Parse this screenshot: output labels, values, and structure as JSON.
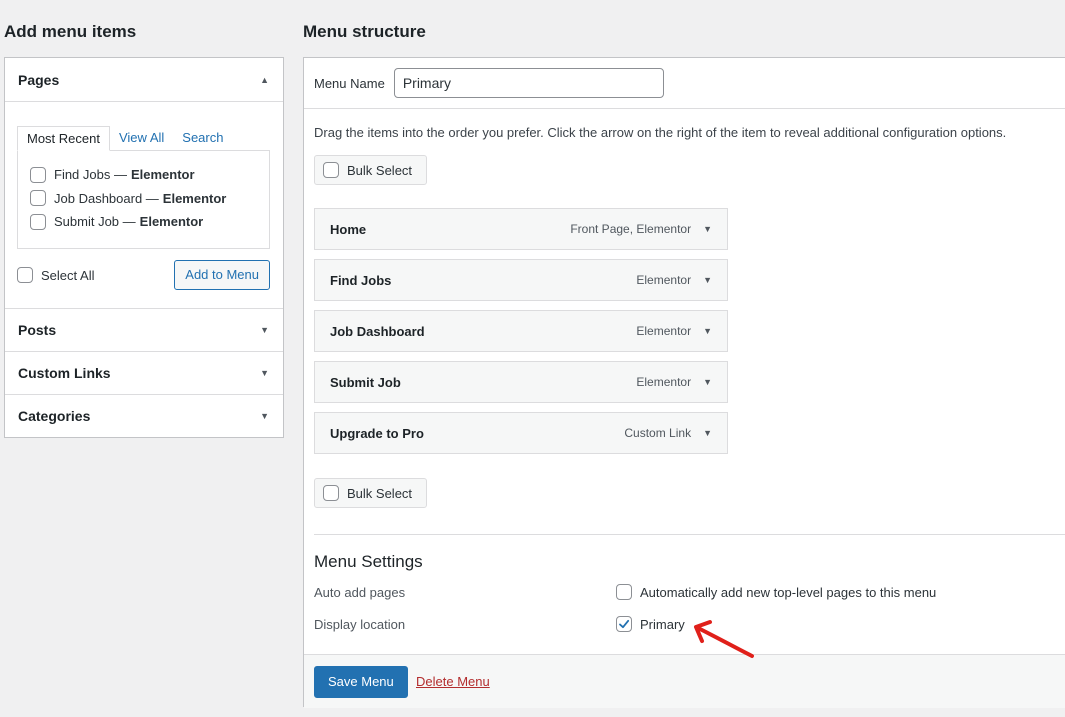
{
  "left": {
    "title": "Add menu items",
    "pages": {
      "label": "Pages",
      "tabs": [
        "Most Recent",
        "View All",
        "Search"
      ],
      "items": [
        {
          "name": "Find Jobs —",
          "tag": "Elementor"
        },
        {
          "name": "Job Dashboard —",
          "tag": "Elementor"
        },
        {
          "name": "Submit Job —",
          "tag": "Elementor"
        }
      ],
      "select_all": "Select All",
      "add_button": "Add to Menu"
    },
    "sections": [
      "Posts",
      "Custom Links",
      "Categories"
    ]
  },
  "right": {
    "title": "Menu structure",
    "menu_name_label": "Menu Name",
    "menu_name_value": "Primary",
    "instructions": "Drag the items into the order you prefer. Click the arrow on the right of the item to reveal additional configuration options.",
    "bulk_select": "Bulk Select",
    "items": [
      {
        "title": "Home",
        "meta": "Front Page, Elementor"
      },
      {
        "title": "Find Jobs",
        "meta": "Elementor"
      },
      {
        "title": "Job Dashboard",
        "meta": "Elementor"
      },
      {
        "title": "Submit Job",
        "meta": "Elementor"
      },
      {
        "title": "Upgrade to Pro",
        "meta": "Custom Link"
      }
    ],
    "settings": {
      "title": "Menu Settings",
      "auto_add_label": "Auto add pages",
      "auto_add_text": "Automatically add new top-level pages to this menu",
      "auto_add_checked": false,
      "display_location_label": "Display location",
      "location_text": "Primary",
      "location_checked": true
    },
    "save_button": "Save Menu",
    "delete_link": "Delete Menu"
  },
  "colors": {
    "accent": "#2271b1",
    "danger": "#b32d2e",
    "annotation_arrow": "#e0201a"
  }
}
